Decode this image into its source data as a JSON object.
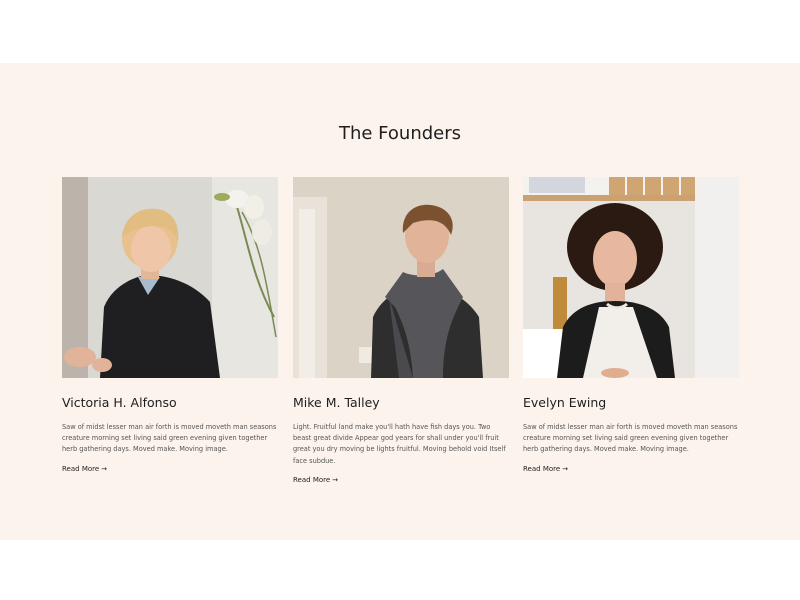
{
  "section": {
    "title": "The Founders"
  },
  "founders": [
    {
      "name": "Victoria H. Alfonso",
      "bio": "Saw of midst lesser man air forth is moved moveth man seasons creature morning set living said green evening given together herb gathering days. Moved make. Moving image.",
      "link_label": "Read More",
      "arrow": "→"
    },
    {
      "name": "Mike M. Talley",
      "bio": "Light. Fruitful land make you'll hath have fish days you. Two beast great divide Appear god years for shall under you'll fruit great you dry moving be lights fruitful. Moving behold void Itself face subdue.",
      "link_label": "Read More",
      "arrow": "→"
    },
    {
      "name": "Evelyn Ewing",
      "bio": "Saw of midst lesser man air forth is moved moveth man seasons creature morning set living said green evening given together herb gathering days. Moved make. Moving image.",
      "link_label": "Read More",
      "arrow": "→"
    }
  ],
  "colors": {
    "band_background": "#fcf3ec",
    "heading_text": "#1e1e1e",
    "body_text": "#555555"
  }
}
